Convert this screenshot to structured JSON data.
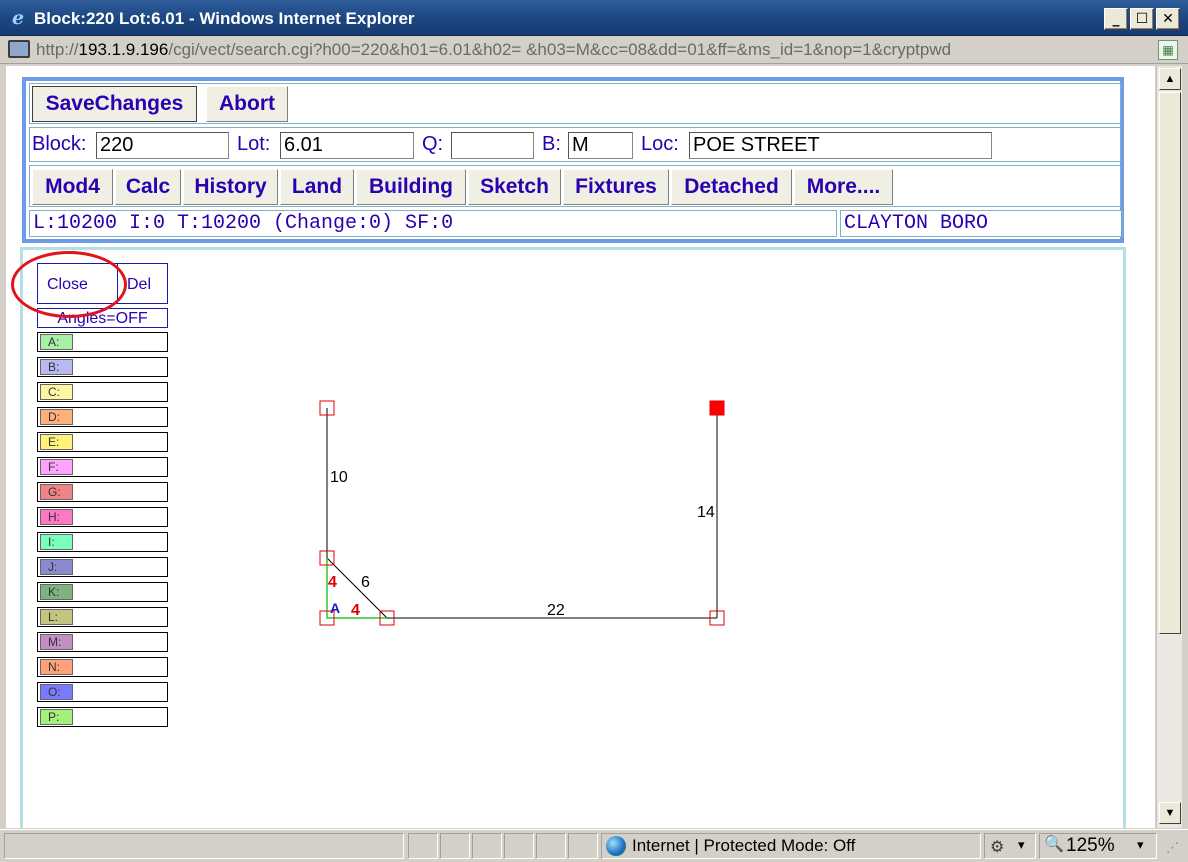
{
  "window": {
    "title": "Block:220 Lot:6.01 - Windows Internet Explorer",
    "buttons": {
      "minimize": "_",
      "maximize": "☐",
      "close": "✕"
    }
  },
  "address": {
    "url_prefix": "http://",
    "host": "193.1.9.196",
    "url_rest": "/cgi/vect/search.cgi?h00=220&h01=6.01&h02= &h03=M&cc=08&dd=01&ff=&ms_id=1&nop=1&cryptpwd"
  },
  "toolbar": {
    "save": "SaveChanges",
    "abort": "Abort"
  },
  "fields": {
    "block_label": "Block:",
    "block_value": "220",
    "lot_label": "Lot:",
    "lot_value": "6.01",
    "q_label": "Q:",
    "q_value": "",
    "b_label": "B:",
    "b_value": "M",
    "loc_label": "Loc:",
    "loc_value": "POE STREET"
  },
  "tabs": [
    "Mod4",
    "Calc",
    "History",
    "Land",
    "Building",
    "Sketch",
    "Fixtures",
    "Detached",
    "More...."
  ],
  "status": {
    "left": "L:10200 I:0 T:10200 (Change:0) SF:0",
    "right": "CLAYTON BORO"
  },
  "sketch_controls": {
    "close": "Close",
    "del": "Del",
    "angles": "Angles=OFF"
  },
  "layers": [
    {
      "label": "A:",
      "color": "#a7f0a7"
    },
    {
      "label": "B:",
      "color": "#b9b9f2"
    },
    {
      "label": "C:",
      "color": "#fff6a3"
    },
    {
      "label": "D:",
      "color": "#ffb07a"
    },
    {
      "label": "E:",
      "color": "#fff27a"
    },
    {
      "label": "F:",
      "color": "#ffa3ff"
    },
    {
      "label": "G:",
      "color": "#f08484"
    },
    {
      "label": "H:",
      "color": "#ff78c4"
    },
    {
      "label": "I:",
      "color": "#7affbe"
    },
    {
      "label": "J:",
      "color": "#8a8ad0"
    },
    {
      "label": "K:",
      "color": "#7fb27f"
    },
    {
      "label": "L:",
      "color": "#c4c482"
    },
    {
      "label": "M:",
      "color": "#c38ec3"
    },
    {
      "label": "N:",
      "color": "#ffa27a"
    },
    {
      "label": "O:",
      "color": "#7a7aff"
    },
    {
      "label": "P:",
      "color": "#a3f07a"
    }
  ],
  "sketch": {
    "dims": {
      "left": "10",
      "diagonal": "6",
      "bottom": "22",
      "right": "14"
    },
    "area_label": "A",
    "area_sides": [
      "4",
      "4"
    ]
  },
  "statusbar": {
    "zone": "Internet | Protected Mode: Off",
    "zoom": "125%"
  }
}
